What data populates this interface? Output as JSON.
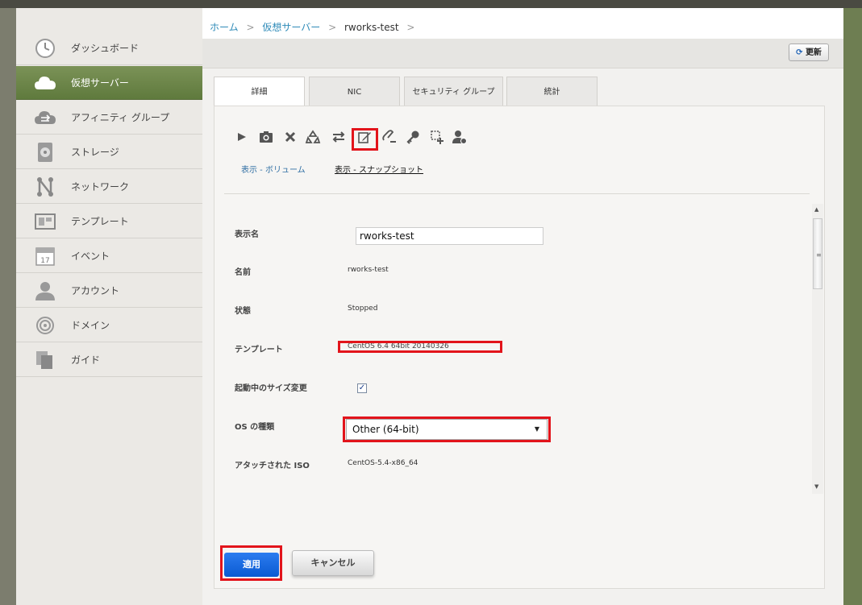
{
  "breadcrumb": {
    "home": "ホーム",
    "vm": "仮想サーバー",
    "current": "rworks-test",
    "sep": ">"
  },
  "header": {
    "refresh_label": "更新"
  },
  "sidebar": {
    "items": [
      {
        "label": "ダッシュボード",
        "icon": "dashboard-icon"
      },
      {
        "label": "仮想サーバー",
        "icon": "cloud-icon",
        "active": true
      },
      {
        "label": "アフィニティ グループ",
        "icon": "cloud-sync-icon"
      },
      {
        "label": "ストレージ",
        "icon": "storage-icon"
      },
      {
        "label": "ネットワーク",
        "icon": "network-icon"
      },
      {
        "label": "テンプレート",
        "icon": "template-icon"
      },
      {
        "label": "イベント",
        "icon": "calendar-icon"
      },
      {
        "label": "アカウント",
        "icon": "user-icon"
      },
      {
        "label": "ドメイン",
        "icon": "domain-icon"
      },
      {
        "label": "ガイド",
        "icon": "guide-icon"
      }
    ]
  },
  "tabs": [
    "詳細",
    "NIC",
    "セキュリティ グループ",
    "統計"
  ],
  "actions": [
    "start-icon",
    "snapshot-icon",
    "destroy-icon",
    "recycle-icon",
    "migrate-icon",
    "edit-icon",
    "detach-iso-icon",
    "key-icon",
    "scale-icon",
    "assign-user-icon"
  ],
  "links": {
    "volumes": "表示 - ボリューム",
    "snapshots": "表示 - スナップショット"
  },
  "form": {
    "display_name_label": "表示名",
    "display_name_value": "rworks-test",
    "name_label": "名前",
    "name_value": "rworks-test",
    "state_label": "状態",
    "state_value": "Stopped",
    "template_label": "テンプレート",
    "template_value": "CentOS 6.4 64bit 20140326",
    "dynamic_scale_label": "起動中のサイズ変更",
    "dynamic_scale_checked": true,
    "os_type_label": "OS の種類",
    "os_type_value": "Other (64-bit)",
    "iso_label": "アタッチされた ISO",
    "iso_value": "CentOS-5.4-x86_64"
  },
  "buttons": {
    "apply": "適用",
    "cancel": "キャンセル"
  },
  "colors": {
    "accent_active": "#6b8547",
    "highlight": "#e2141b",
    "apply_blue": "#1866e0"
  }
}
